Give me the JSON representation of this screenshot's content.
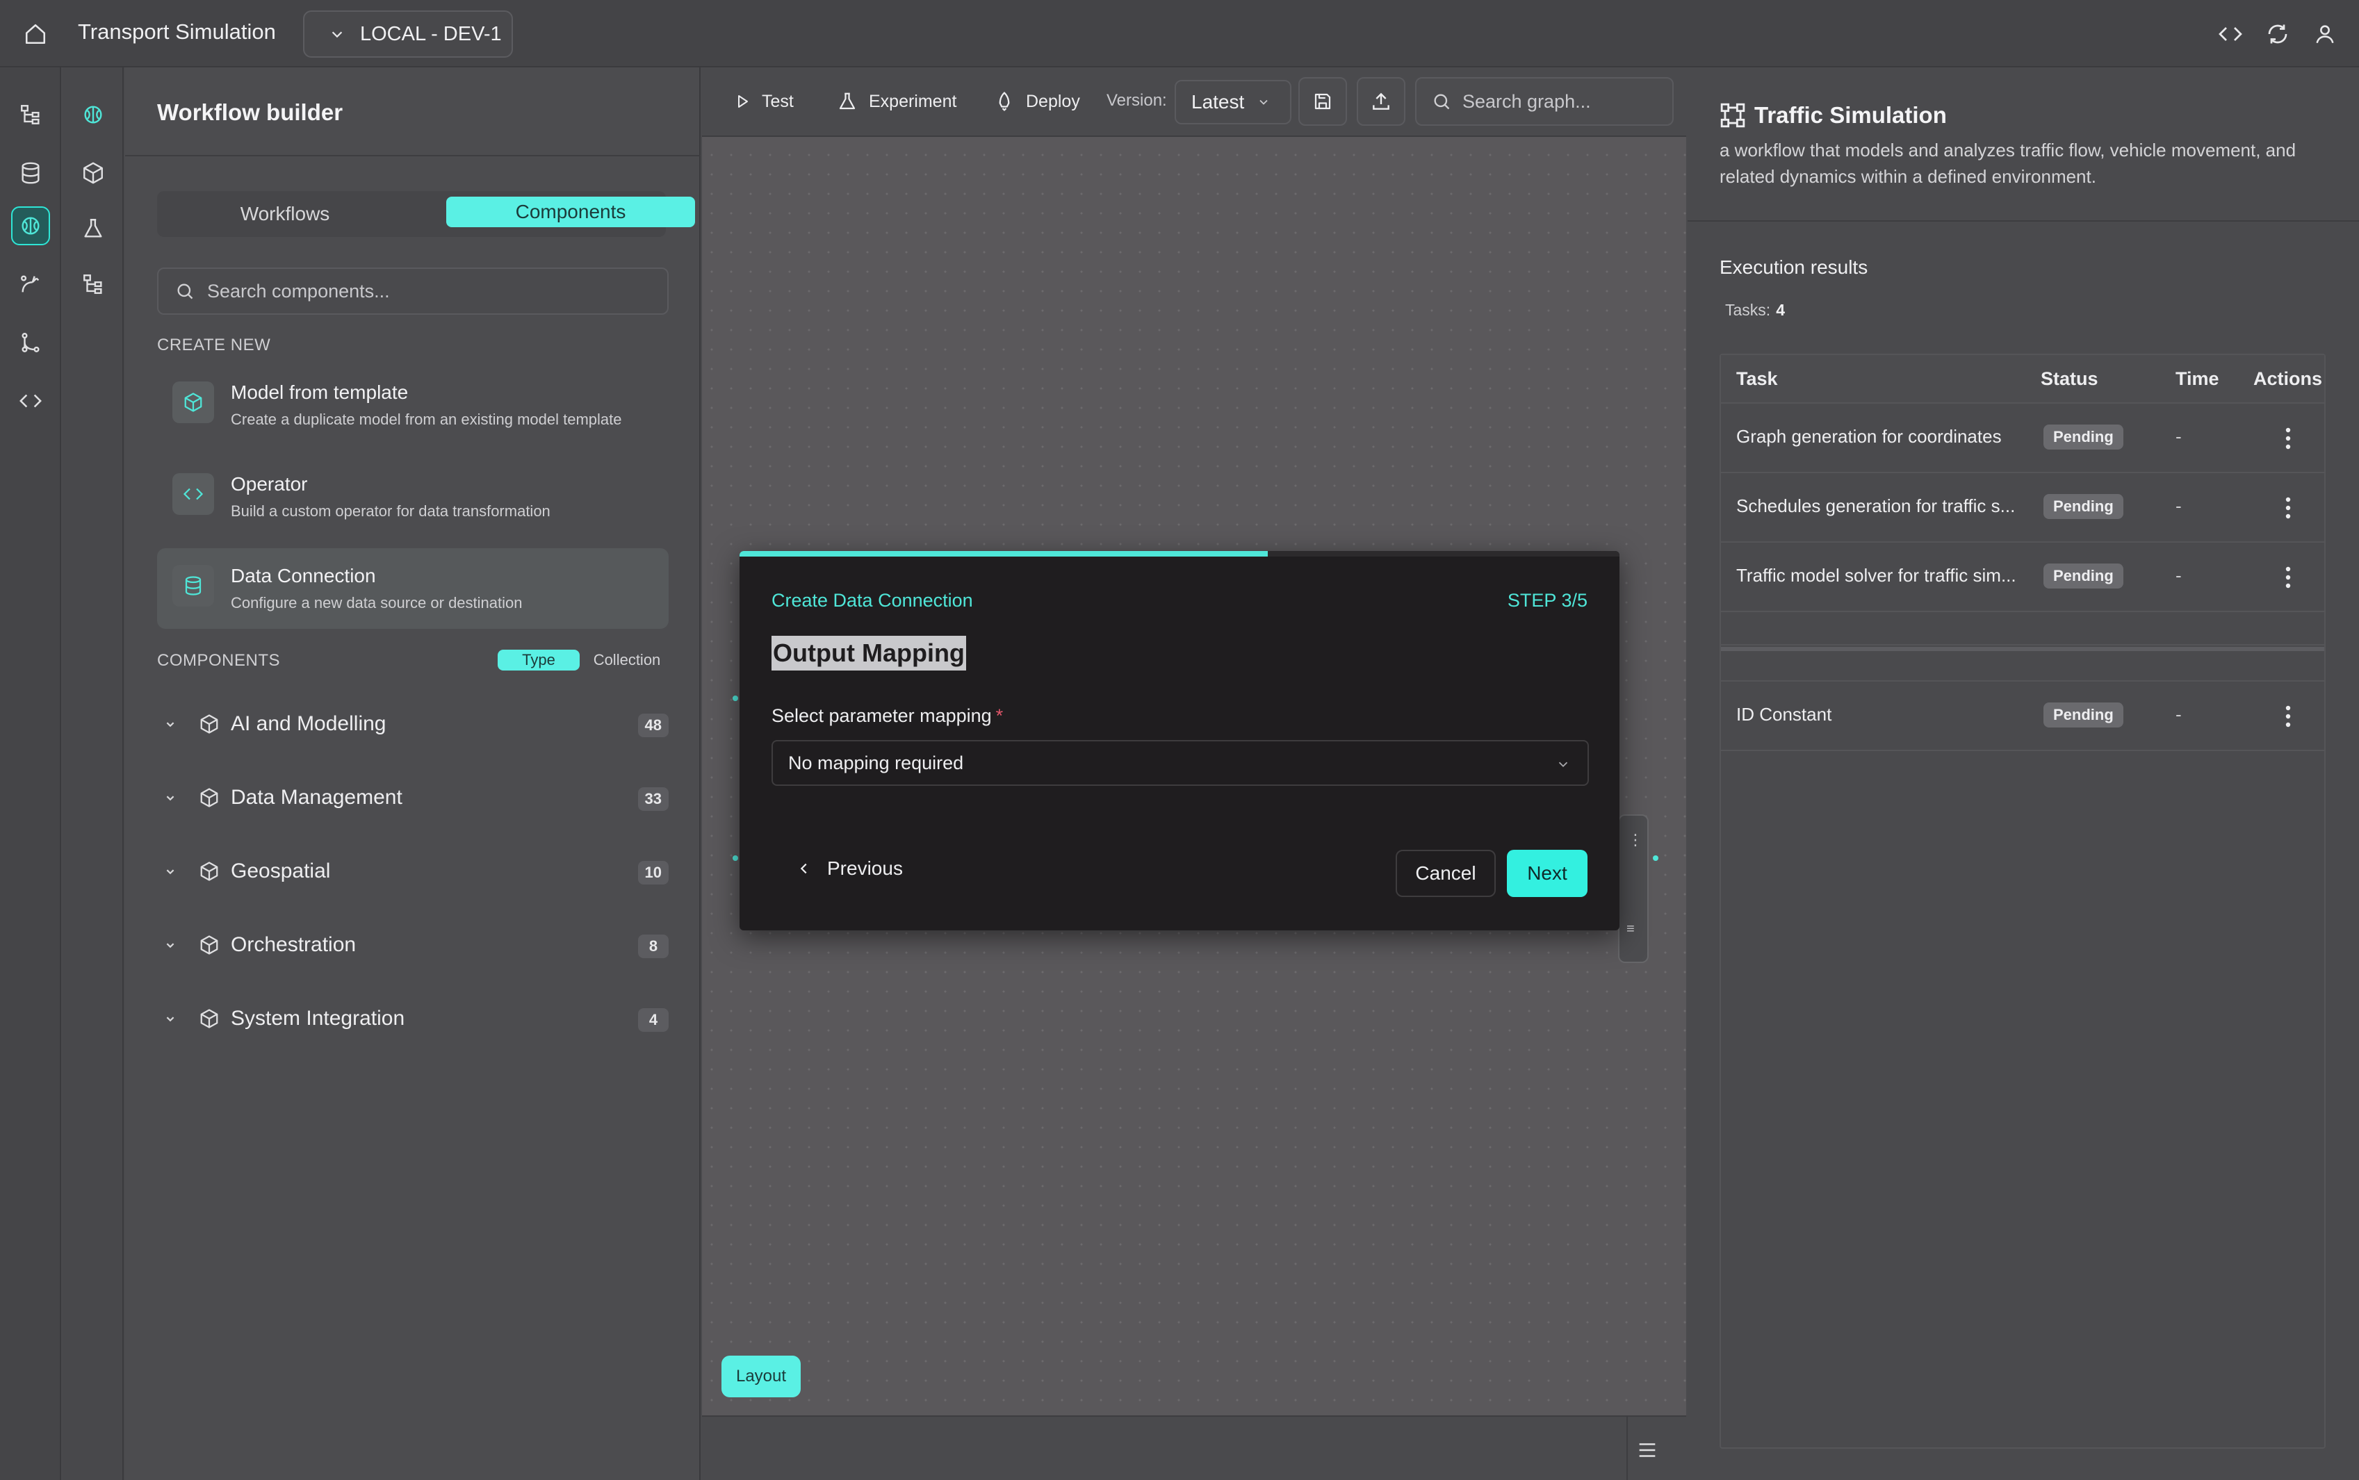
{
  "topbar": {
    "app_title": "Transport Simulation",
    "environment": "LOCAL - DEV-1"
  },
  "left_panel": {
    "title": "Workflow builder",
    "tabs": {
      "workflows": "Workflows",
      "components": "Components",
      "active": "Components"
    },
    "search_placeholder": "Search components...",
    "create_new_label": "CREATE NEW",
    "create_items": [
      {
        "title": "Model from template",
        "description": "Create a duplicate model from an existing model template",
        "icon": "cube-icon"
      },
      {
        "title": "Operator",
        "description": "Build a custom operator for data transformation",
        "icon": "code-icon"
      },
      {
        "title": "Data Connection",
        "description": "Configure a new data source or destination",
        "icon": "database-icon"
      }
    ],
    "components_label": "COMPONENTS",
    "group_by": {
      "type": "Type",
      "collection": "Collection",
      "active": "Type"
    },
    "categories": [
      {
        "label": "AI and Modelling",
        "count": "48"
      },
      {
        "label": "Data Management",
        "count": "33"
      },
      {
        "label": "Geospatial",
        "count": "10"
      },
      {
        "label": "Orchestration",
        "count": "8"
      },
      {
        "label": "System Integration",
        "count": "4"
      }
    ]
  },
  "toolbar": {
    "test": "Test",
    "experiment": "Experiment",
    "deploy": "Deploy",
    "version_label": "Version:",
    "version_value": "Latest",
    "search_placeholder": "Search graph..."
  },
  "canvas": {
    "layout_button": "Layout"
  },
  "modal": {
    "kicker": "Create Data Connection",
    "step": "STEP 3/5",
    "step_current": 3,
    "step_total": 5,
    "title": "Output Mapping",
    "field_label": "Select parameter mapping",
    "required_mark": "*",
    "select_value": "No mapping required",
    "previous": "Previous",
    "cancel": "Cancel",
    "next": "Next"
  },
  "right_panel": {
    "title": "Traffic Simulation",
    "description": "a workflow that models and analyzes traffic flow, vehicle movement, and related dynamics within a defined environment.",
    "execution_label": "Execution results",
    "tasks_label": "Tasks:",
    "tasks_count": "4",
    "columns": {
      "task": "Task",
      "status": "Status",
      "time": "Time",
      "actions": "Actions"
    },
    "rows": [
      {
        "task": "Graph generation for coordinates",
        "status": "Pending",
        "time": "-"
      },
      {
        "task": "Schedules generation for traffic s...",
        "status": "Pending",
        "time": "-"
      },
      {
        "task": "Traffic model solver for traffic sim...",
        "status": "Pending",
        "time": "-"
      }
    ],
    "constant_rows": [
      {
        "task": "ID Constant",
        "status": "Pending",
        "time": "-"
      }
    ]
  },
  "colors": {
    "accent": "#4fe6d8",
    "accent_fill": "#5af0e4",
    "background": "#4a4a4d",
    "modal_bg": "#1f1d1f"
  }
}
